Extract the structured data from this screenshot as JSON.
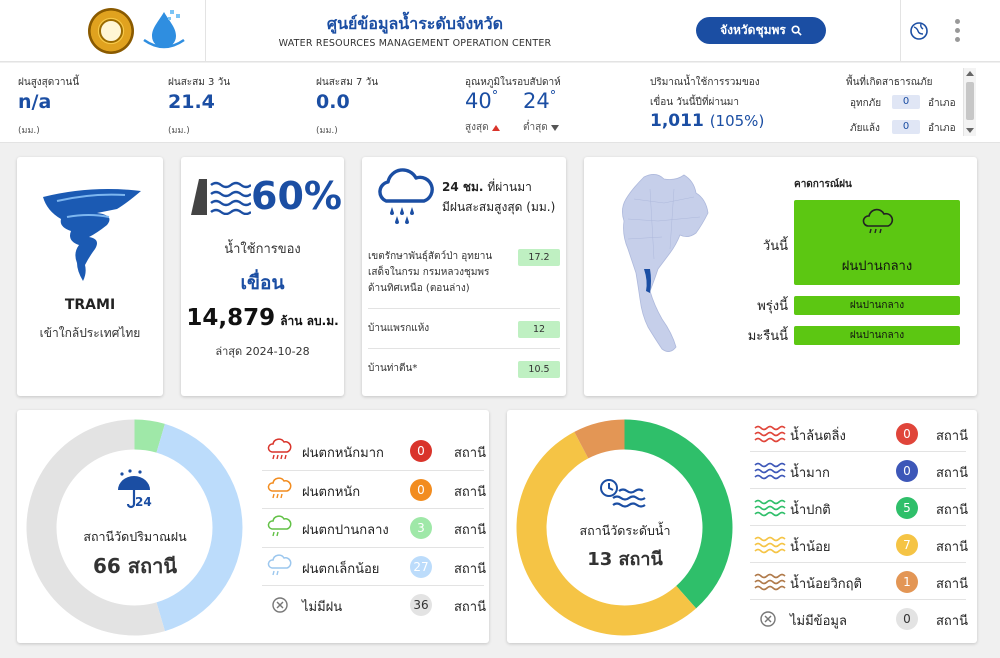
{
  "header": {
    "title": "ศูนย์ข้อมูลน้ำระดับจังหวัด",
    "subtitle": "WATER RESOURCES MANAGEMENT OPERATION CENTER",
    "province_button": "จังหวัดชุมพร"
  },
  "stats": {
    "rain_today": {
      "label": "ฝนสูงสุดวานนี้",
      "value": "n/a",
      "unit": "(มม.)"
    },
    "rain_3day": {
      "label": "ฝนสะสม 3 วัน",
      "value": "21.4",
      "unit": "(มม.)"
    },
    "rain_7day": {
      "label": "ฝนสะสม 7 วัน",
      "value": "0.0",
      "unit": "(มม.)"
    },
    "temp": {
      "label": "อุณหภูมิในรอบสัปดาห์",
      "max": "40",
      "max_label": "สูงสุด",
      "min": "24",
      "min_label": "ต่ำสุด",
      "deg": "°"
    },
    "dam_storage": {
      "label1": "ปริมาณน้ำใช้การรวมของ",
      "label2": "เขื่อน วันนี้ปีที่ผ่านมา",
      "value": "1,011",
      "pct": "(105%)"
    },
    "disaster": {
      "label": "พื้นที่เกิดสาธารณภัย",
      "flood_label": "อุทกภัย",
      "flood_count": "0",
      "drought_label": "ภัยแล้ง",
      "drought_count": "0",
      "unit": "อำเภอ"
    }
  },
  "storm": {
    "name": "TRAMI",
    "desc": "เข้าใกล้ประเทศไทย",
    "icon": "tornado-icon",
    "color": "#1b4ea3"
  },
  "dam": {
    "pct": "60%",
    "line1": "น้ำใช้การของ",
    "line2": "เขื่อน",
    "volume": "14,879",
    "volume_unit": "ล้าน ลบ.ม.",
    "date": "ล่าสุด 2024-10-28"
  },
  "rain24": {
    "title_bold": "24 ชม.",
    "title_rest": " ที่ผ่านมา",
    "title_line2": "มีฝนสะสมสูงสุด (มม.)",
    "rows": [
      {
        "name_lines": [
          "เขตรักษาพันธุ์สัตว์ป่า อุทยาน",
          "เสด็จในกรม กรมหลวงชุมพร",
          "ด้านทิศเหนือ (ตอนล่าง)"
        ],
        "value": "17.2"
      },
      {
        "name_lines": [
          "บ้านแพรกแห้ง"
        ],
        "value": "12"
      },
      {
        "name_lines": [
          "บ้านท่าตีน*"
        ],
        "value": "10.5"
      }
    ]
  },
  "forecast": {
    "title": "คาดการณ์ฝน",
    "today_label": "วันนี้",
    "today_value": "ฝนปานกลาง",
    "tomorrow_label": "พรุ่งนี้",
    "tomorrow_value": "ฝนปานกลาง",
    "day_after_label": "มะรืนนี้",
    "day_after_value": "ฝนปานกลาง",
    "color": "#5cc712"
  },
  "rain_stations": {
    "title": "สถานีวัดปริมาณฝน",
    "total": "66 สถานี",
    "total_count": 66,
    "unit": "สถานี",
    "items": [
      {
        "label": "ฝนตกหนักมาก",
        "count": 0,
        "color": "#d9342b",
        "icon": "heavy-rain-icon"
      },
      {
        "label": "ฝนตกหนัก",
        "count": 0,
        "color": "#f28c1f",
        "icon": "heavy-rain-icon"
      },
      {
        "label": "ฝนตกปานกลาง",
        "count": 3,
        "color": "#9fe8a8",
        "icon": "moderate-rain-icon"
      },
      {
        "label": "ฝนตกเล็กน้อย",
        "count": 27,
        "color": "#bcdcfb",
        "icon": "light-rain-icon"
      },
      {
        "label": "ไม่มีฝน",
        "count": 36,
        "color": "#e3e3e3",
        "icon": "no-rain-icon"
      }
    ]
  },
  "water_stations": {
    "title": "สถานีวัดระดับน้ำ",
    "total": "13 สถานี",
    "unit": "สถานี",
    "items": [
      {
        "label": "น้ำล้นตลิ่ง",
        "count": 0,
        "color": "#e0453a",
        "icon": "overflow-wave-icon"
      },
      {
        "label": "น้ำมาก",
        "count": 0,
        "color": "#3d57b8",
        "icon": "high-wave-icon"
      },
      {
        "label": "น้ำปกติ",
        "count": 5,
        "color": "#2fbf6a",
        "icon": "normal-wave-icon"
      },
      {
        "label": "น้ำน้อย",
        "count": 7,
        "color": "#f5c445",
        "icon": "low-wave-icon"
      },
      {
        "label": "น้ำน้อยวิกฤติ",
        "count": 1,
        "color": "#e39655",
        "icon": "critical-wave-icon"
      },
      {
        "label": "ไม่มีข้อมูล",
        "count": 0,
        "color": "#e3e3e3",
        "icon": "no-data-icon"
      }
    ]
  }
}
